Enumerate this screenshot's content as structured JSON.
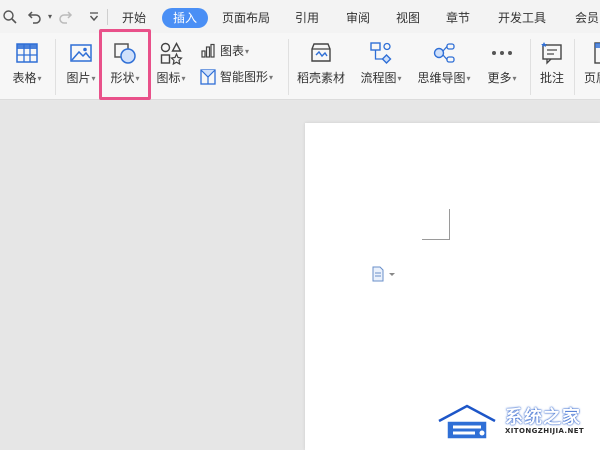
{
  "tabs": [
    {
      "label": "开始"
    },
    {
      "label": "插入",
      "active": true
    },
    {
      "label": "页面布局"
    },
    {
      "label": "引用"
    },
    {
      "label": "审阅"
    },
    {
      "label": "视图"
    },
    {
      "label": "章节"
    },
    {
      "label": "开发工具"
    },
    {
      "label": "会员"
    }
  ],
  "ribbon": {
    "table": "表格",
    "picture": "图片",
    "shape": "形状",
    "icon": "图标",
    "chart": "图表",
    "smart_shape": "智能图形",
    "materials": "稻壳素材",
    "flowchart": "流程图",
    "mindmap": "思维导图",
    "more": "更多",
    "comment": "批注",
    "header": "页眉"
  },
  "colors": {
    "accent": "#4a8ff5",
    "highlight_box": "#e9518a"
  },
  "watermark": {
    "name": "系统之家",
    "url": "XITONGZHIJIA.NET"
  }
}
